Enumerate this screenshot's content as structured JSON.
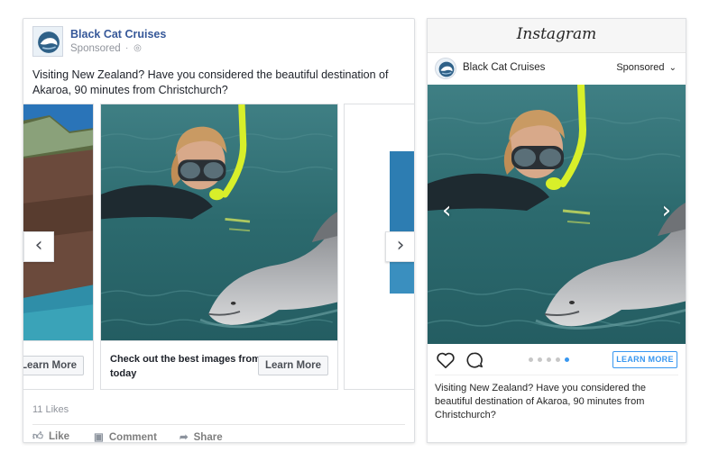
{
  "facebook": {
    "page_name": "Black Cat Cruises",
    "sponsored": "Sponsored",
    "sponsored_sep": "·",
    "caption": "Visiting New Zealand? Have you considered the beautiful destination of Akaroa, 90 minutes from Christchurch?",
    "cards": [
      {
        "cta": "Learn More"
      },
      {
        "title": "Check out the best images from today",
        "cta": "Learn More"
      }
    ],
    "likes": "11 Likes",
    "actions": {
      "like": "Like",
      "comment": "Comment",
      "share": "Share"
    },
    "icons": {
      "prev": "chevron-left-icon",
      "next": "chevron-right-icon",
      "globe": "globe-icon"
    }
  },
  "instagram": {
    "wordmark": "Instagram",
    "account": "Black Cat Cruises",
    "sponsored": "Sponsored",
    "cta": "LEARN MORE",
    "caption": "Visiting New Zealand? Have you considered the beautiful destination of Akaroa, 90 minutes from Christchurch?",
    "carousel_count": 5,
    "carousel_active": 5,
    "icons": {
      "heart": "heart-icon",
      "comment": "comment-icon",
      "prev": "chevron-left-icon",
      "next": "chevron-right-icon",
      "dropdown": "chevron-down-icon"
    }
  },
  "colors": {
    "facebook_link": "#365899",
    "instagram_accent": "#3897f0",
    "water": "#2f6f73",
    "snorkel": "#d8ef2a"
  }
}
